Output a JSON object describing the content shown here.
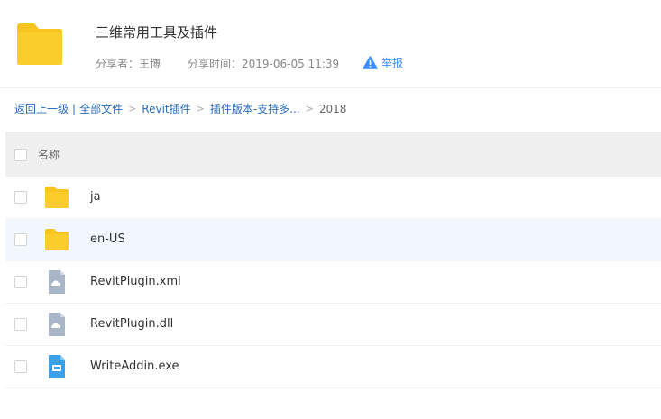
{
  "share": {
    "title": "三维常用工具及插件",
    "sharer": "分享者：王博",
    "time": "分享时间：2019-06-05 11:39",
    "report_label": "举报"
  },
  "breadcrumb": {
    "back": "返回上一级",
    "separator_bar": "|",
    "all_files": "全部文件",
    "arrow": ">",
    "items": [
      "Revit插件",
      "插件版本-支持多..."
    ],
    "current": "2018"
  },
  "list": {
    "header_name": "名称",
    "rows": [
      {
        "name": "ja",
        "icon": "folder-icon"
      },
      {
        "name": "en-US",
        "icon": "folder-icon"
      },
      {
        "name": "RevitPlugin.xml",
        "icon": "file-cloud-icon"
      },
      {
        "name": "RevitPlugin.dll",
        "icon": "file-cloud-icon"
      },
      {
        "name": "WriteAddin.exe",
        "icon": "exe-file-icon"
      }
    ]
  },
  "colors": {
    "folder": "#f8c520",
    "link": "#2a6cbd",
    "report": "#3b8cff",
    "highlight_row": "#f1f7fd",
    "file_gray": "#a9b6c7",
    "exe_blue": "#3aa0e8"
  }
}
